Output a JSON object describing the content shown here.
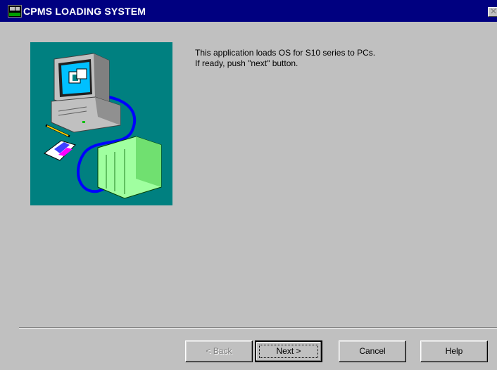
{
  "window": {
    "title": "CPMS LOADING SYSTEM",
    "close_glyph": "✕"
  },
  "illustration": {
    "icon": "pc-and-controller-illustration",
    "background_color": "#008080"
  },
  "message": {
    "line1": "This application loads OS for S10 series to PCs.",
    "line2": "If ready, push \"next\" button."
  },
  "buttons": {
    "back": {
      "label": "< Back",
      "enabled": false
    },
    "next": {
      "label": "Next >",
      "enabled": true,
      "default": true
    },
    "cancel": {
      "label": "Cancel",
      "enabled": true
    },
    "help": {
      "label": "Help",
      "enabled": true
    }
  }
}
